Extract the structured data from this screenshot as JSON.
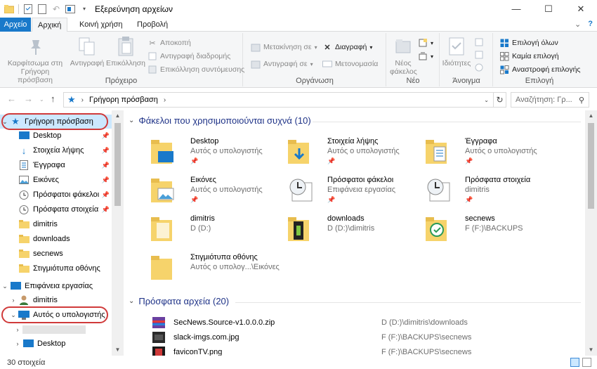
{
  "window": {
    "title": "Εξερεύνηση αρχείων",
    "minimize": "—",
    "maximize": "☐",
    "close": "✕"
  },
  "ribbon_tabs": [
    "Αρχείο",
    "Αρχική",
    "Κοινή χρήση",
    "Προβολή"
  ],
  "ribbon": {
    "clipboard": {
      "pin_label_1": "Καρφίτσωμα στη",
      "pin_label_2": "Γρήγορη πρόσβαση",
      "copy": "Αντιγραφή",
      "paste": "Επικόλληση",
      "cut": "Αποκοπή",
      "copy_path": "Αντιγραφή διαδρομής",
      "paste_shortcut": "Επικόλληση συντόμευσης",
      "group_label": "Πρόχειρο"
    },
    "organize": {
      "move_to": "Μετακίνηση σε",
      "copy_to": "Αντιγραφή σε",
      "delete": "Διαγραφή",
      "rename": "Μετονομασία",
      "group_label": "Οργάνωση"
    },
    "new": {
      "new_folder_1": "Νέος",
      "new_folder_2": "φάκελος",
      "group_label": "Νέο"
    },
    "open": {
      "properties": "Ιδιότητες",
      "group_label": "Άνοιγμα"
    },
    "select": {
      "select_all": "Επιλογή όλων",
      "select_none": "Καμία επιλογή",
      "invert": "Αναστροφή επιλογής",
      "group_label": "Επιλογή"
    }
  },
  "address": {
    "crumb": "Γρήγορη πρόσβαση",
    "search_placeholder": "Αναζήτηση: Γρ..."
  },
  "nav": {
    "quick_access": "Γρήγορη πρόσβαση",
    "items": [
      {
        "label": "Desktop",
        "pinned": true
      },
      {
        "label": "Στοιχεία λήψης",
        "pinned": true
      },
      {
        "label": "Έγγραφα",
        "pinned": true
      },
      {
        "label": "Εικόνες",
        "pinned": true
      },
      {
        "label": "Πρόσφατοι φάκελοι",
        "pinned": true
      },
      {
        "label": "Πρόσφατα στοιχεία",
        "pinned": true
      },
      {
        "label": "dimitris",
        "pinned": false
      },
      {
        "label": "downloads",
        "pinned": false
      },
      {
        "label": "secnews",
        "pinned": false
      },
      {
        "label": "Στιγμιότυπα οθόνης",
        "pinned": false
      }
    ],
    "desktop_root": "Επιφάνεια εργασίας",
    "user": "dimitris",
    "this_pc": "Αυτός ο υπολογιστής",
    "pc_desktop": "Desktop"
  },
  "frequent": {
    "header": "Φάκελοι που χρησιμοποιούνται συχνά (10)",
    "tiles": [
      {
        "name": "Desktop",
        "sub": "Αυτός ο υπολογιστής",
        "pinned": true
      },
      {
        "name": "Στοιχεία λήψης",
        "sub": "Αυτός ο υπολογιστής",
        "pinned": true
      },
      {
        "name": "Έγγραφα",
        "sub": "Αυτός ο υπολογιστής",
        "pinned": true
      },
      {
        "name": "Εικόνες",
        "sub": "Αυτός ο υπολογιστής",
        "pinned": true
      },
      {
        "name": "Πρόσφατοι φάκελοι",
        "sub": "Επιφάνεια εργασίας",
        "pinned": true
      },
      {
        "name": "Πρόσφατα στοιχεία",
        "sub": "dimitris",
        "pinned": true
      },
      {
        "name": "dimitris",
        "sub": "D (D:)",
        "pinned": false
      },
      {
        "name": "downloads",
        "sub": "D (D:)\\dimitris",
        "pinned": false
      },
      {
        "name": "secnews",
        "sub": "F (F:)\\BACKUPS",
        "pinned": false
      },
      {
        "name": "Στιγμιότυπα οθόνης",
        "sub": "Αυτός ο υπολογ...\\Εικόνες",
        "pinned": false
      }
    ]
  },
  "recent": {
    "header": "Πρόσφατα αρχεία (20)",
    "files": [
      {
        "name": "SecNews.Source-v1.0.0.0.zip",
        "path": "D (D:)\\dimitris\\downloads"
      },
      {
        "name": "slack-imgs.com.jpg",
        "path": "F (F:)\\BACKUPS\\secnews"
      },
      {
        "name": "faviconTV.png",
        "path": "F (F:)\\BACKUPS\\secnews"
      }
    ]
  },
  "status": {
    "count": "30 στοιχεία"
  },
  "colors": {
    "accent": "#1979ca",
    "header_blue": "#1e3287",
    "highlight_circle": "#d03a3a",
    "folder_yellow": "#f6d36b"
  }
}
